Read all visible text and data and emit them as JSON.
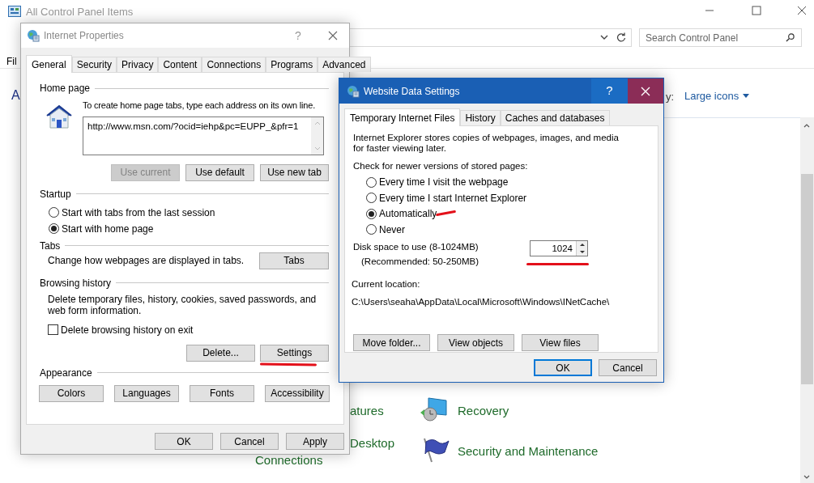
{
  "background_window": {
    "title": "All Control Panel Items",
    "search": {
      "placeholder": "Search Control Panel"
    },
    "menu_fragment": "Fil",
    "heading_fragment": "A",
    "view_by_fragment": "y:",
    "view_mode": "Large icons",
    "items": [
      {
        "label": "atures"
      },
      {
        "label": "Desktop"
      },
      {
        "label": "Connections"
      },
      {
        "label": "Recovery"
      },
      {
        "label": "Security and Maintenance"
      }
    ]
  },
  "internet_properties": {
    "title": "Internet Properties",
    "help_button": "?",
    "tabs": [
      {
        "label": "General",
        "selected": true
      },
      {
        "label": "Security",
        "selected": false
      },
      {
        "label": "Privacy",
        "selected": false
      },
      {
        "label": "Content",
        "selected": false
      },
      {
        "label": "Connections",
        "selected": false
      },
      {
        "label": "Programs",
        "selected": false
      },
      {
        "label": "Advanced",
        "selected": false
      }
    ],
    "home_page": {
      "label": "Home page",
      "instruction": "To create home page tabs, type each address on its own line.",
      "url": "http://www.msn.com/?ocid=iehp&pc=EUPP_&pfr=1",
      "buttons": [
        {
          "label": "Use current",
          "disabled": true
        },
        {
          "label": "Use default",
          "disabled": false
        },
        {
          "label": "Use new tab",
          "disabled": false
        }
      ]
    },
    "startup": {
      "label": "Startup",
      "options": [
        {
          "label": "Start with tabs from the last session",
          "selected": false
        },
        {
          "label": "Start with home page",
          "selected": true
        }
      ]
    },
    "tabs_section": {
      "label": "Tabs",
      "description": "Change how webpages are displayed in tabs.",
      "button": "Tabs"
    },
    "browsing_history": {
      "label": "Browsing history",
      "description": "Delete temporary files, history, cookies, saved passwords, and web form information.",
      "checkbox": {
        "label": "Delete browsing history on exit",
        "checked": false
      },
      "buttons": [
        "Delete...",
        "Settings"
      ]
    },
    "appearance": {
      "label": "Appearance",
      "buttons": [
        "Colors",
        "Languages",
        "Fonts",
        "Accessibility"
      ]
    },
    "footer_buttons": [
      {
        "label": "OK",
        "default": false
      },
      {
        "label": "Cancel",
        "default": false
      },
      {
        "label": "Apply",
        "default": false
      }
    ]
  },
  "website_data_settings": {
    "title": "Website Data Settings",
    "help_button": "?",
    "tabs": [
      {
        "label": "Temporary Internet Files",
        "selected": true
      },
      {
        "label": "History",
        "selected": false
      },
      {
        "label": "Caches and databases",
        "selected": false
      }
    ],
    "description": "Internet Explorer stores copies of webpages, images, and media for faster viewing later.",
    "check_label": "Check for newer versions of stored pages:",
    "options": [
      {
        "label": "Every time I visit the webpage",
        "selected": false
      },
      {
        "label": "Every time I start Internet Explorer",
        "selected": false
      },
      {
        "label": "Automatically",
        "selected": true
      },
      {
        "label": "Never",
        "selected": false
      }
    ],
    "disk_space_label": "Disk space to use (8-1024MB)",
    "recommended": "(Recommended: 50-250MB)",
    "disk_space_value": "1024",
    "location_label": "Current location:",
    "location_path": "C:\\Users\\seaha\\AppData\\Local\\Microsoft\\Windows\\INetCache\\",
    "buttons": [
      "Move folder...",
      "View objects",
      "View files"
    ],
    "footer_buttons": [
      {
        "label": "OK",
        "default": true
      },
      {
        "label": "Cancel",
        "default": false
      }
    ]
  }
}
